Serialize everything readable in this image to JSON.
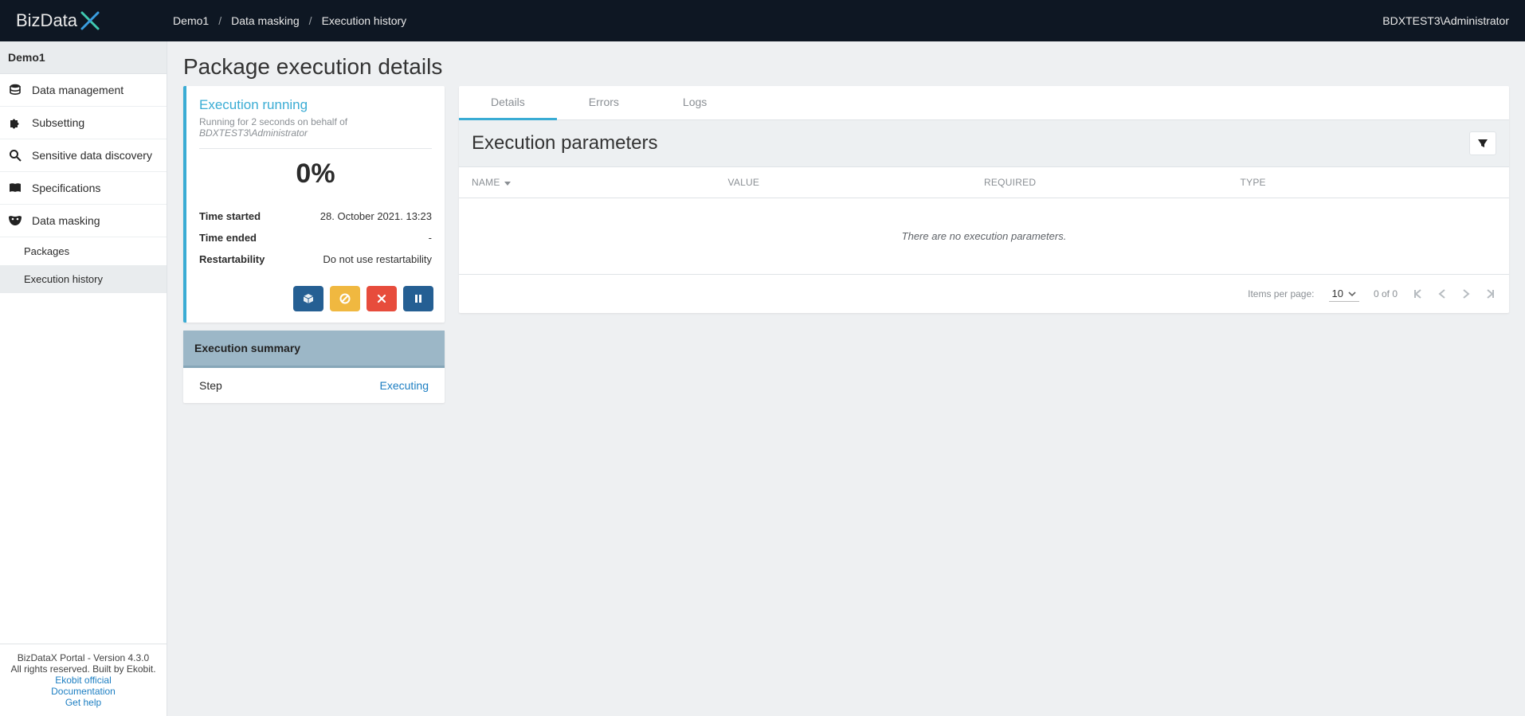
{
  "topbar": {
    "logo": "BizData",
    "user": "BDXTEST3\\Administrator"
  },
  "breadcrumb": [
    "Demo1",
    "Data masking",
    "Execution history"
  ],
  "sidebar": {
    "header": "Demo1",
    "items": [
      {
        "label": "Data management"
      },
      {
        "label": "Subsetting"
      },
      {
        "label": "Sensitive data discovery"
      },
      {
        "label": "Specifications"
      },
      {
        "label": "Data masking"
      }
    ],
    "subitems": [
      {
        "label": "Packages"
      },
      {
        "label": "Execution history"
      }
    ],
    "footer": {
      "line1": "BizDataX Portal - Version 4.3.0",
      "line2": "All rights reserved. Built by Ekobit.",
      "links": [
        "Ekobit official",
        "Documentation",
        "Get help"
      ]
    }
  },
  "page": {
    "title": "Package execution details"
  },
  "status": {
    "title": "Execution running",
    "subtext": "Running for 2 seconds on behalf of",
    "who": "BDXTEST3\\Administrator",
    "percent": "0%",
    "kv": [
      {
        "k": "Time started",
        "v": "28. October 2021. 13:23"
      },
      {
        "k": "Time ended",
        "v": "-"
      },
      {
        "k": "Restartability",
        "v": "Do not use restartability"
      }
    ]
  },
  "summary": {
    "head": "Execution summary",
    "step_label": "Step",
    "status": "Executing"
  },
  "tabs": [
    "Details",
    "Errors",
    "Logs"
  ],
  "panel": {
    "title": "Execution parameters",
    "columns": [
      "NAME",
      "VALUE",
      "REQUIRED",
      "TYPE"
    ],
    "empty": "There are no execution parameters.",
    "pager": {
      "label": "Items per page:",
      "size": "10",
      "range": "0 of 0"
    }
  }
}
